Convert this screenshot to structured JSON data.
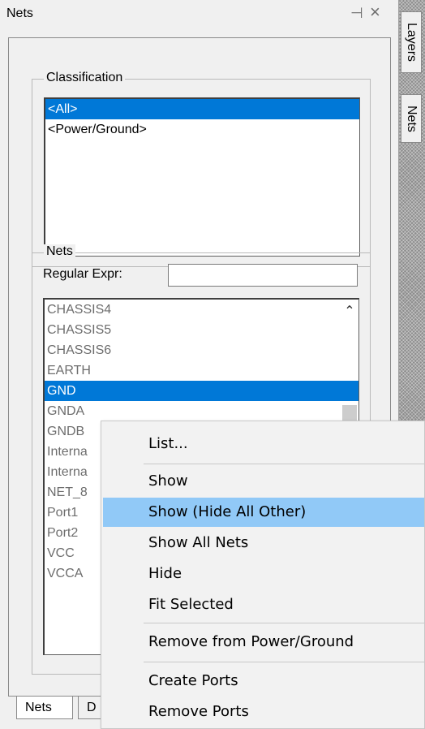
{
  "window": {
    "title": "Nets",
    "pin_symbol": "⊣",
    "close_symbol": "×"
  },
  "classification": {
    "label": "Classification",
    "items": [
      "<All>",
      "<Power/Ground>"
    ],
    "selected_index": 0
  },
  "nets": {
    "label": "Nets",
    "regex_label": "Regular Expr:",
    "regex_value": "",
    "items": [
      "CHASSIS4",
      "CHASSIS5",
      "CHASSIS6",
      "EARTH",
      "GND",
      "GNDA",
      "GNDB",
      "Interna",
      "Interna",
      "NET_8",
      "Port1",
      "Port2",
      "VCC",
      "VCCA"
    ],
    "selected_index": 4,
    "scroll_up_symbol": "⌃"
  },
  "bottom_tabs": [
    "Nets",
    "D"
  ],
  "side_tabs": [
    "Layers",
    "Nets"
  ],
  "context_menu": {
    "items": [
      "List...",
      "Show",
      "Show (Hide All Other)",
      "Show All Nets",
      "Hide",
      "Fit Selected",
      "Remove from Power/Ground",
      "Create Ports",
      "Remove Ports"
    ],
    "highlighted_index": 2
  },
  "colors": {
    "selection": "#0078d7",
    "menu_highlight": "#91c9f7",
    "panel_bg": "#f0f0f0"
  }
}
